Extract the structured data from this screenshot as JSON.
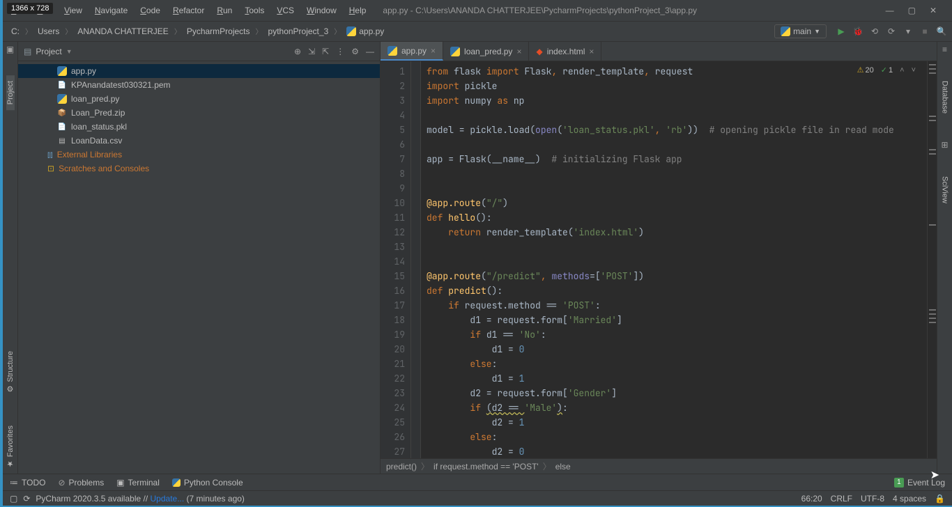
{
  "dim_badge": "1366 x 728",
  "menus": [
    "File",
    "Edit",
    "View",
    "Navigate",
    "Code",
    "Refactor",
    "Run",
    "Tools",
    "VCS",
    "Window",
    "Help"
  ],
  "window_title": "app.py - C:\\Users\\ANANDA CHATTERJEE\\PycharmProjects\\pythonProject_3\\app.py",
  "breadcrumbs": [
    "C:",
    "Users",
    "ANANDA CHATTERJEE",
    "PycharmProjects",
    "pythonProject_3",
    "app.py"
  ],
  "run_config": "main",
  "left_gutter": [
    "Project",
    "Structure",
    "Favorites"
  ],
  "right_gutter": [
    "Database",
    "SciView"
  ],
  "project_panel": {
    "title": "Project",
    "files": [
      {
        "name": "app.py",
        "icon": "py",
        "selected": true
      },
      {
        "name": "KPAnandatest030321.pem",
        "icon": "file"
      },
      {
        "name": "loan_pred.py",
        "icon": "py"
      },
      {
        "name": "Loan_Pred.zip",
        "icon": "zip"
      },
      {
        "name": "loan_status.pkl",
        "icon": "file"
      },
      {
        "name": "LoanData.csv",
        "icon": "csv"
      }
    ],
    "libs": [
      "External Libraries",
      "Scratches and Consoles"
    ]
  },
  "tabs": [
    {
      "label": "app.py",
      "icon": "py",
      "active": true
    },
    {
      "label": "loan_pred.py",
      "icon": "py"
    },
    {
      "label": "index.html",
      "icon": "html"
    }
  ],
  "code_status": {
    "warn": "20",
    "ok": "1"
  },
  "line_numbers": [
    "1",
    "2",
    "3",
    "4",
    "5",
    "6",
    "7",
    "8",
    "9",
    "10",
    "11",
    "12",
    "13",
    "14",
    "15",
    "16",
    "17",
    "18",
    "19",
    "20",
    "21",
    "22",
    "23",
    "24",
    "25",
    "26",
    "27"
  ],
  "code_lines": [
    [
      {
        "t": "from ",
        "c": "kw"
      },
      {
        "t": "flask ",
        "c": ""
      },
      {
        "t": "import ",
        "c": "kw"
      },
      {
        "t": "Flask",
        "c": ""
      },
      {
        "t": ", ",
        "c": "kw"
      },
      {
        "t": "render_template",
        "c": ""
      },
      {
        "t": ", ",
        "c": "kw"
      },
      {
        "t": "request",
        "c": ""
      }
    ],
    [
      {
        "t": "import ",
        "c": "kw"
      },
      {
        "t": "pickle",
        "c": ""
      }
    ],
    [
      {
        "t": "import ",
        "c": "kw"
      },
      {
        "t": "numpy ",
        "c": ""
      },
      {
        "t": "as ",
        "c": "kw"
      },
      {
        "t": "np",
        "c": ""
      }
    ],
    [
      {
        "t": "",
        "c": ""
      }
    ],
    [
      {
        "t": "model = pickle.load(",
        "c": ""
      },
      {
        "t": "open",
        "c": "bi"
      },
      {
        "t": "(",
        "c": ""
      },
      {
        "t": "'loan_status.pkl'",
        "c": "str"
      },
      {
        "t": ", ",
        "c": "kw"
      },
      {
        "t": "'rb'",
        "c": "str"
      },
      {
        "t": "))  ",
        "c": ""
      },
      {
        "t": "# opening pickle file in read mode",
        "c": "cmt"
      }
    ],
    [
      {
        "t": "",
        "c": ""
      }
    ],
    [
      {
        "t": "app = Flask(__name__)  ",
        "c": ""
      },
      {
        "t": "# initializing Flask app",
        "c": "cmt"
      }
    ],
    [
      {
        "t": "",
        "c": ""
      }
    ],
    [
      {
        "t": "",
        "c": ""
      }
    ],
    [
      {
        "t": "@app.route",
        "c": "fn"
      },
      {
        "t": "(",
        "c": ""
      },
      {
        "t": "\"/\"",
        "c": "str"
      },
      {
        "t": ")",
        "c": ""
      }
    ],
    [
      {
        "t": "def ",
        "c": "kw"
      },
      {
        "t": "hello",
        "c": "fn"
      },
      {
        "t": "():",
        "c": ""
      }
    ],
    [
      {
        "t": "    ",
        "c": ""
      },
      {
        "t": "return ",
        "c": "kw"
      },
      {
        "t": "render_template(",
        "c": ""
      },
      {
        "t": "'index.html'",
        "c": "str"
      },
      {
        "t": ")",
        "c": ""
      }
    ],
    [
      {
        "t": "",
        "c": ""
      }
    ],
    [
      {
        "t": "",
        "c": ""
      }
    ],
    [
      {
        "t": "@app.route",
        "c": "fn"
      },
      {
        "t": "(",
        "c": ""
      },
      {
        "t": "\"/predict\"",
        "c": "str"
      },
      {
        "t": ", ",
        "c": "kw"
      },
      {
        "t": "methods",
        "c": "bi"
      },
      {
        "t": "=[",
        "c": ""
      },
      {
        "t": "'POST'",
        "c": "str"
      },
      {
        "t": "])",
        "c": ""
      }
    ],
    [
      {
        "t": "def ",
        "c": "kw"
      },
      {
        "t": "predict",
        "c": "fn"
      },
      {
        "t": "():",
        "c": ""
      }
    ],
    [
      {
        "t": "    ",
        "c": ""
      },
      {
        "t": "if ",
        "c": "kw"
      },
      {
        "t": "request.method == ",
        "c": ""
      },
      {
        "t": "'POST'",
        "c": "str"
      },
      {
        "t": ":",
        "c": ""
      }
    ],
    [
      {
        "t": "        d1 = request.form[",
        "c": ""
      },
      {
        "t": "'Married'",
        "c": "str"
      },
      {
        "t": "]",
        "c": ""
      }
    ],
    [
      {
        "t": "        ",
        "c": ""
      },
      {
        "t": "if ",
        "c": "kw"
      },
      {
        "t": "d1 == ",
        "c": ""
      },
      {
        "t": "'No'",
        "c": "str"
      },
      {
        "t": ":",
        "c": ""
      }
    ],
    [
      {
        "t": "            d1 = ",
        "c": ""
      },
      {
        "t": "0",
        "c": "num"
      }
    ],
    [
      {
        "t": "        ",
        "c": ""
      },
      {
        "t": "else",
        "c": "kw"
      },
      {
        "t": ":",
        "c": ""
      }
    ],
    [
      {
        "t": "            d1 = ",
        "c": ""
      },
      {
        "t": "1",
        "c": "num"
      }
    ],
    [
      {
        "t": "        d2 = request.form[",
        "c": ""
      },
      {
        "t": "'Gender'",
        "c": "str"
      },
      {
        "t": "]",
        "c": ""
      }
    ],
    [
      {
        "t": "        ",
        "c": ""
      },
      {
        "t": "if ",
        "c": "kw"
      },
      {
        "t": "(d2 == ",
        "c": "warn"
      },
      {
        "t": "'Male'",
        "c": "str"
      },
      {
        "t": ")",
        "c": "warn"
      },
      {
        "t": ":",
        "c": ""
      }
    ],
    [
      {
        "t": "            d2 = ",
        "c": ""
      },
      {
        "t": "1",
        "c": "num"
      }
    ],
    [
      {
        "t": "        ",
        "c": ""
      },
      {
        "t": "else",
        "c": "kw"
      },
      {
        "t": ":",
        "c": ""
      }
    ],
    [
      {
        "t": "            d2 = ",
        "c": ""
      },
      {
        "t": "0",
        "c": "num"
      }
    ]
  ],
  "breadcrumb_bottom": [
    "predict()",
    "if request.method == 'POST'",
    "else"
  ],
  "bottom_tools": [
    "TODO",
    "Problems",
    "Terminal",
    "Python Console"
  ],
  "event_log": {
    "count": "1",
    "label": "Event Log"
  },
  "statusbar": {
    "msg_prefix": "PyCharm 2020.3.5 available // ",
    "link": "Update...",
    "msg_suffix": " (7 minutes ago)",
    "pos": "66:20",
    "sep": "CRLF",
    "enc": "UTF-8",
    "indent": "4 spaces"
  }
}
